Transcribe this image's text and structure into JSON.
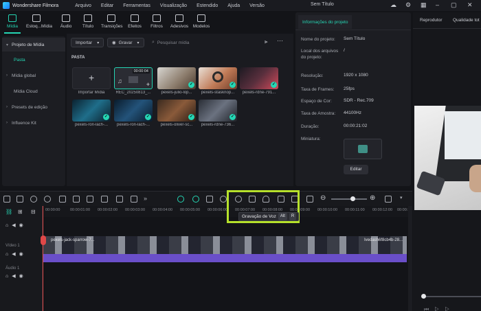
{
  "app": {
    "name": "Wondershare Filmora",
    "document_title": "Sem Título",
    "menu": [
      "Arquivo",
      "Editar",
      "Ferramentas",
      "Visualização",
      "Estendido",
      "Ajuda",
      "Versão"
    ]
  },
  "toolbar": {
    "tabs": [
      {
        "label": "Mídia",
        "icon": "media-icon",
        "active": true
      },
      {
        "label": "Estoq...Mídia",
        "icon": "stock-media-icon"
      },
      {
        "label": "Áudio",
        "icon": "music-note-icon"
      },
      {
        "label": "Título",
        "icon": "text-icon"
      },
      {
        "label": "Transições",
        "icon": "transitions-icon"
      },
      {
        "label": "Efeitos",
        "icon": "effects-icon"
      },
      {
        "label": "Filtros",
        "icon": "filters-icon"
      },
      {
        "label": "Adesivos",
        "icon": "stickers-icon"
      },
      {
        "label": "Modelos",
        "icon": "templates-icon"
      }
    ]
  },
  "sidebar": {
    "items": [
      {
        "label": "Projeto de Mídia",
        "caret": "▾"
      },
      {
        "label": "Pasta"
      },
      {
        "label": "Mídia global",
        "caret": "›"
      },
      {
        "label": "Mídia Cloud"
      },
      {
        "label": "Presets de edição",
        "caret": "›"
      },
      {
        "label": "Influence Kit",
        "caret": "›"
      }
    ]
  },
  "media": {
    "import_label": "Importar",
    "record_label": "Gravar",
    "search_placeholder": "Pesquisar mídia",
    "folder_label": "PASTA",
    "import_tile_label": "Importar Mídia",
    "items": [
      {
        "label": "REC_20250813_...",
        "duration": "00:00:04"
      },
      {
        "label": "pexels-julio-lop..."
      },
      {
        "label": "pexels-stasknop..."
      },
      {
        "label": "pexels-rdne-791..."
      },
      {
        "label": "pexels-ron-lach-..."
      },
      {
        "label": "pexels-ron-lach-..."
      },
      {
        "label": "pexels-oliver-sc..."
      },
      {
        "label": "pexels-rdne-736..."
      }
    ]
  },
  "project_info": {
    "tab_label": "Informações do projeto",
    "fields": [
      {
        "key": "Nome do projeto:",
        "value": "Sem Título"
      },
      {
        "key": "Local dos arquivos do projeto:",
        "value": "/"
      },
      {
        "key": "Resolução:",
        "value": "1920 x 1080"
      },
      {
        "key": "Taxa de Frames:",
        "value": "25fps"
      },
      {
        "key": "Espaço de Cor:",
        "value": "SDR - Rec.709"
      },
      {
        "key": "Taxa de Amostra:",
        "value": "44100Hz"
      },
      {
        "key": "Duração:",
        "value": "00:00:21:02"
      },
      {
        "key": "Miniatura:",
        "value": ""
      }
    ],
    "edit_label": "Editar"
  },
  "player": {
    "tabs": [
      "Reprodutor",
      "Qualidade tot"
    ]
  },
  "timeline": {
    "ruler": [
      "00:00:00",
      "00:00:01:00",
      "00:00:02:00",
      "00:00:03:00",
      "00:00:04:00",
      "00:00:05:00",
      "00:00:06:00",
      "00:00:07:00",
      "00:00:08:00",
      "00:00:09:00",
      "00:00:10:00",
      "00:00:11:00",
      "00:00:12:00",
      "00:00:13"
    ],
    "tracks": [
      {
        "label": "Vídeo 1"
      },
      {
        "label": "Áudio 1"
      }
    ],
    "clip_label": "pexels-jack-sparrow-7...",
    "clip_label_end": "Ivedash6f8cb4b-28..."
  },
  "tooltip": {
    "label": "Gravação de Voz",
    "keys": [
      "Alt",
      "R"
    ]
  },
  "colors": {
    "accent": "#25d6b4",
    "highlight": "#b6e12b",
    "audio": "#6a4fc9",
    "playhead": "#e04848"
  }
}
